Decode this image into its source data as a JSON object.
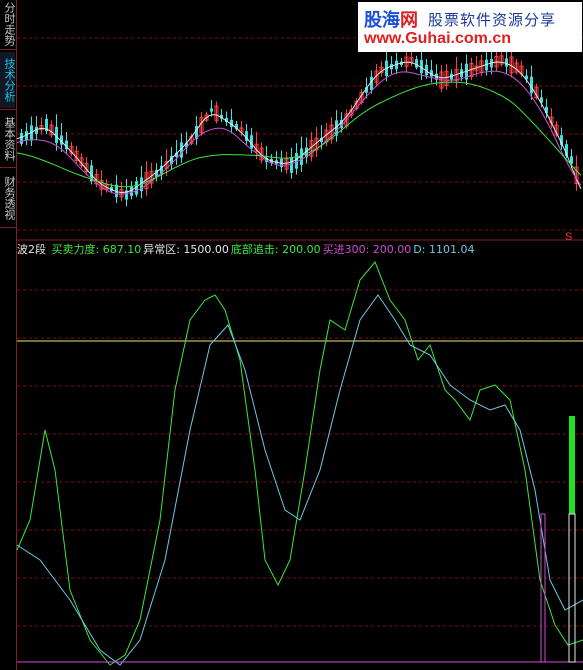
{
  "side_tabs": [
    {
      "label": "分时走势",
      "active": false
    },
    {
      "label": "技术分析",
      "active": true
    },
    {
      "label": "基本资料",
      "active": false
    },
    {
      "label": "财务透视",
      "active": false
    }
  ],
  "watermark": {
    "brand_main": "股海",
    "brand_accent": "网",
    "slogan": "股票软件资源分享",
    "url": "www.Guhai.com.cn"
  },
  "indicator_header": {
    "name": "波2段",
    "items": [
      {
        "label": "买卖力度:",
        "value": "687.10",
        "color": "#3ce63c"
      },
      {
        "label": "异常区:",
        "value": "1500.00",
        "color": "#e6e6e6"
      },
      {
        "label": "底部追击:",
        "value": "200.00",
        "color": "#3ce63c"
      },
      {
        "label": "买进300:",
        "value": "200.00",
        "color": "#d24cd2"
      },
      {
        "label": "D:",
        "value": "1101.04",
        "color": "#6ec8e6"
      }
    ]
  },
  "price_marker": "S",
  "colors": {
    "up_candle": "#ff4040",
    "down_candle": "#40e0e0",
    "ma_white": "#e6e6e6",
    "ma_magenta": "#d24cd2",
    "ma_green": "#3ce63c",
    "osc_green": "#3ce63c",
    "osc_blue": "#6ec8e6",
    "level_line": "#e6e680",
    "grid": "#7a1414",
    "signal_bar": "#20e020",
    "signal_outline": "#e6e6e6"
  }
}
